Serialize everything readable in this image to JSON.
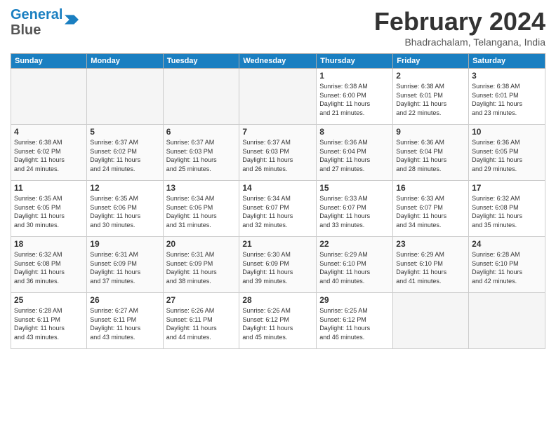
{
  "header": {
    "logo_line1": "General",
    "logo_line2": "Blue",
    "month_title": "February 2024",
    "location": "Bhadrachalam, Telangana, India"
  },
  "weekdays": [
    "Sunday",
    "Monday",
    "Tuesday",
    "Wednesday",
    "Thursday",
    "Friday",
    "Saturday"
  ],
  "weeks": [
    [
      {
        "day": "",
        "info": ""
      },
      {
        "day": "",
        "info": ""
      },
      {
        "day": "",
        "info": ""
      },
      {
        "day": "",
        "info": ""
      },
      {
        "day": "1",
        "info": "Sunrise: 6:38 AM\nSunset: 6:00 PM\nDaylight: 11 hours\nand 21 minutes."
      },
      {
        "day": "2",
        "info": "Sunrise: 6:38 AM\nSunset: 6:01 PM\nDaylight: 11 hours\nand 22 minutes."
      },
      {
        "day": "3",
        "info": "Sunrise: 6:38 AM\nSunset: 6:01 PM\nDaylight: 11 hours\nand 23 minutes."
      }
    ],
    [
      {
        "day": "4",
        "info": "Sunrise: 6:38 AM\nSunset: 6:02 PM\nDaylight: 11 hours\nand 24 minutes."
      },
      {
        "day": "5",
        "info": "Sunrise: 6:37 AM\nSunset: 6:02 PM\nDaylight: 11 hours\nand 24 minutes."
      },
      {
        "day": "6",
        "info": "Sunrise: 6:37 AM\nSunset: 6:03 PM\nDaylight: 11 hours\nand 25 minutes."
      },
      {
        "day": "7",
        "info": "Sunrise: 6:37 AM\nSunset: 6:03 PM\nDaylight: 11 hours\nand 26 minutes."
      },
      {
        "day": "8",
        "info": "Sunrise: 6:36 AM\nSunset: 6:04 PM\nDaylight: 11 hours\nand 27 minutes."
      },
      {
        "day": "9",
        "info": "Sunrise: 6:36 AM\nSunset: 6:04 PM\nDaylight: 11 hours\nand 28 minutes."
      },
      {
        "day": "10",
        "info": "Sunrise: 6:36 AM\nSunset: 6:05 PM\nDaylight: 11 hours\nand 29 minutes."
      }
    ],
    [
      {
        "day": "11",
        "info": "Sunrise: 6:35 AM\nSunset: 6:05 PM\nDaylight: 11 hours\nand 30 minutes."
      },
      {
        "day": "12",
        "info": "Sunrise: 6:35 AM\nSunset: 6:06 PM\nDaylight: 11 hours\nand 30 minutes."
      },
      {
        "day": "13",
        "info": "Sunrise: 6:34 AM\nSunset: 6:06 PM\nDaylight: 11 hours\nand 31 minutes."
      },
      {
        "day": "14",
        "info": "Sunrise: 6:34 AM\nSunset: 6:07 PM\nDaylight: 11 hours\nand 32 minutes."
      },
      {
        "day": "15",
        "info": "Sunrise: 6:33 AM\nSunset: 6:07 PM\nDaylight: 11 hours\nand 33 minutes."
      },
      {
        "day": "16",
        "info": "Sunrise: 6:33 AM\nSunset: 6:07 PM\nDaylight: 11 hours\nand 34 minutes."
      },
      {
        "day": "17",
        "info": "Sunrise: 6:32 AM\nSunset: 6:08 PM\nDaylight: 11 hours\nand 35 minutes."
      }
    ],
    [
      {
        "day": "18",
        "info": "Sunrise: 6:32 AM\nSunset: 6:08 PM\nDaylight: 11 hours\nand 36 minutes."
      },
      {
        "day": "19",
        "info": "Sunrise: 6:31 AM\nSunset: 6:09 PM\nDaylight: 11 hours\nand 37 minutes."
      },
      {
        "day": "20",
        "info": "Sunrise: 6:31 AM\nSunset: 6:09 PM\nDaylight: 11 hours\nand 38 minutes."
      },
      {
        "day": "21",
        "info": "Sunrise: 6:30 AM\nSunset: 6:09 PM\nDaylight: 11 hours\nand 39 minutes."
      },
      {
        "day": "22",
        "info": "Sunrise: 6:29 AM\nSunset: 6:10 PM\nDaylight: 11 hours\nand 40 minutes."
      },
      {
        "day": "23",
        "info": "Sunrise: 6:29 AM\nSunset: 6:10 PM\nDaylight: 11 hours\nand 41 minutes."
      },
      {
        "day": "24",
        "info": "Sunrise: 6:28 AM\nSunset: 6:10 PM\nDaylight: 11 hours\nand 42 minutes."
      }
    ],
    [
      {
        "day": "25",
        "info": "Sunrise: 6:28 AM\nSunset: 6:11 PM\nDaylight: 11 hours\nand 43 minutes."
      },
      {
        "day": "26",
        "info": "Sunrise: 6:27 AM\nSunset: 6:11 PM\nDaylight: 11 hours\nand 43 minutes."
      },
      {
        "day": "27",
        "info": "Sunrise: 6:26 AM\nSunset: 6:11 PM\nDaylight: 11 hours\nand 44 minutes."
      },
      {
        "day": "28",
        "info": "Sunrise: 6:26 AM\nSunset: 6:12 PM\nDaylight: 11 hours\nand 45 minutes."
      },
      {
        "day": "29",
        "info": "Sunrise: 6:25 AM\nSunset: 6:12 PM\nDaylight: 11 hours\nand 46 minutes."
      },
      {
        "day": "",
        "info": ""
      },
      {
        "day": "",
        "info": ""
      }
    ]
  ]
}
